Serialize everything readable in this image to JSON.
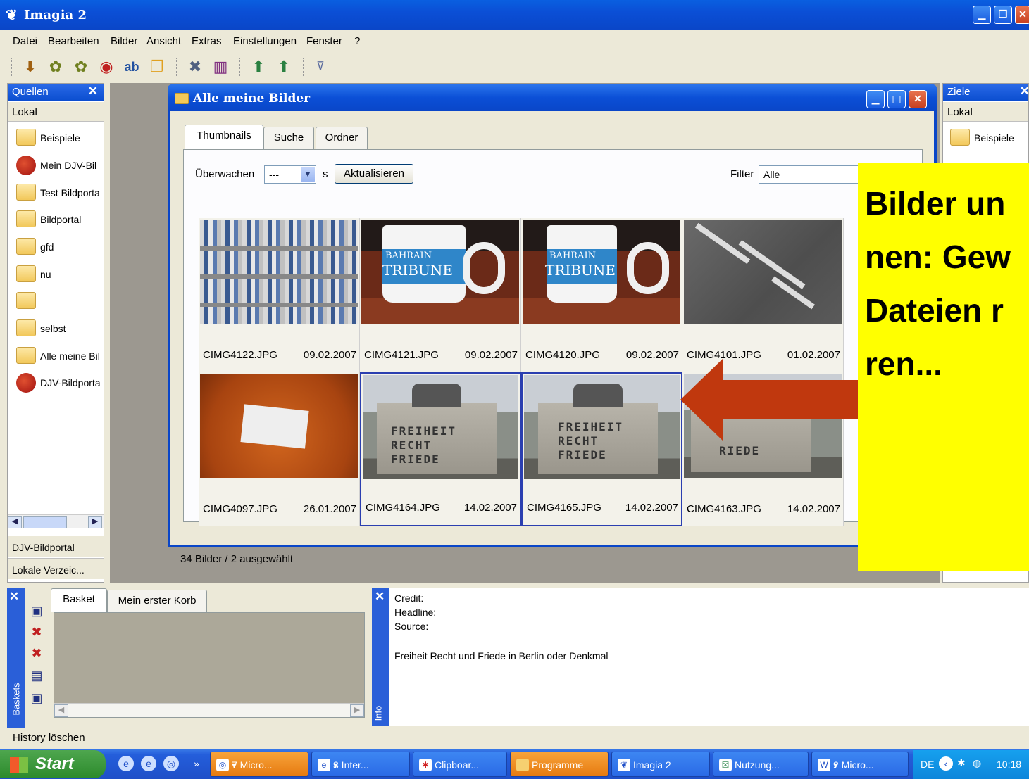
{
  "window": {
    "title": "Imagia 2",
    "controls": [
      "minimize",
      "maximize",
      "close"
    ]
  },
  "menu": [
    "Datei",
    "Bearbeiten",
    "Bilder",
    "Ansicht",
    "Extras",
    "Einstellungen",
    "Fenster",
    "?"
  ],
  "toolbar_icons": [
    "import-icon",
    "camera-icon",
    "camera2-icon",
    "globe-icon",
    "rename-icon",
    "copy-icon",
    "tools-icon",
    "books-icon",
    "upload-icon",
    "upload2-icon",
    "pin-icon"
  ],
  "left_panel": {
    "header": "Quellen",
    "subheader": "Lokal",
    "items": [
      {
        "label": "Beispiele",
        "icon": "folder"
      },
      {
        "label": "Mein DJV-Bil",
        "icon": "globe"
      },
      {
        "label": "Test Bildporta",
        "icon": "folder"
      },
      {
        "label": "Bildportal",
        "icon": "folder"
      },
      {
        "label": "gfd",
        "icon": "folder"
      },
      {
        "label": "nu",
        "icon": "folder"
      },
      {
        "label": "",
        "icon": "folder"
      },
      {
        "label": "selbst",
        "icon": "folder"
      },
      {
        "label": "Alle meine Bil",
        "icon": "folder"
      },
      {
        "label": "DJV-Bildporta",
        "icon": "globe"
      }
    ],
    "bottom_tabs": [
      "DJV-Bildportal",
      "Lokale Verzeic..."
    ]
  },
  "dialog": {
    "title": "Alle meine Bilder",
    "tabs": [
      "Thumbnails",
      "Suche",
      "Ordner"
    ],
    "active_tab": "Thumbnails",
    "watch_label": "Überwachen",
    "watch_value": "---",
    "watch_unit": "s",
    "refresh_button": "Aktualisieren",
    "filter_label": "Filter",
    "filter_value": "Alle",
    "thumbnails": [
      {
        "name": "CIMG4122.JPG",
        "date": "09.02.2007",
        "selected": false
      },
      {
        "name": "CIMG4121.JPG",
        "date": "09.02.2007",
        "selected": false
      },
      {
        "name": "CIMG4120.JPG",
        "date": "09.02.2007",
        "selected": false
      },
      {
        "name": "CIMG4101.JPG",
        "date": "01.02.2007",
        "selected": false
      },
      {
        "name": "CIMG4097.JPG",
        "date": "26.01.2007",
        "selected": false
      },
      {
        "name": "CIMG4164.JPG",
        "date": "14.02.2007",
        "selected": true
      },
      {
        "name": "CIMG4165.JPG",
        "date": "14.02.2007",
        "selected": true
      },
      {
        "name": "CIMG4163.JPG",
        "date": "14.02.2007",
        "selected": false
      }
    ],
    "photo_text": {
      "mug_line1": "BAHRAIN",
      "mug_line2": "TRIBUNE",
      "monument": "FREIHEIT\nRECHT\nFRIEDE",
      "monument_partial": "RIEDE"
    },
    "status": "34 Bilder / 2 ausgewählt"
  },
  "right_panel": {
    "header": "Ziele",
    "subheader": "Lokal",
    "items": [
      {
        "label": "Beispiele"
      }
    ]
  },
  "callout": {
    "lines": [
      "Bilder un",
      "nen: Gew",
      "Dateien r",
      "ren..."
    ],
    "color": "#ffff00"
  },
  "arrow_color": "#c0380e",
  "baskets": {
    "bar_label": "Baskets",
    "tabs": [
      "Basket",
      "Mein erster Korb"
    ],
    "active_tab": "Basket",
    "icons": [
      "basket-add-icon",
      "basket-remove-icon",
      "basket-delete-icon",
      "basket-export-icon",
      "basket-copy-icon"
    ]
  },
  "info": {
    "bar_label": "Info",
    "credit": "Credit:",
    "headline": "Headline:",
    "source": "Source:",
    "description": "Freiheit Recht und Friede in Berlin oder Denkmal"
  },
  "history_label": "History löschen",
  "taskbar": {
    "start": "Start",
    "tasks": [
      {
        "label": "7 Micro...",
        "style": "orange",
        "dropdown": true
      },
      {
        "label": "3 Inter...",
        "style": "blue",
        "dropdown": true
      },
      {
        "label": "Clipboar...",
        "style": "blue",
        "dropdown": false
      },
      {
        "label": "Programme",
        "style": "orange",
        "dropdown": false
      },
      {
        "label": "Imagia 2",
        "style": "blue",
        "dropdown": false
      },
      {
        "label": "Nutzung...",
        "style": "blue",
        "dropdown": false
      },
      {
        "label": "2 Micro...",
        "style": "blue",
        "dropdown": true
      }
    ],
    "tray": {
      "lang": "DE",
      "time": "10:18"
    }
  }
}
